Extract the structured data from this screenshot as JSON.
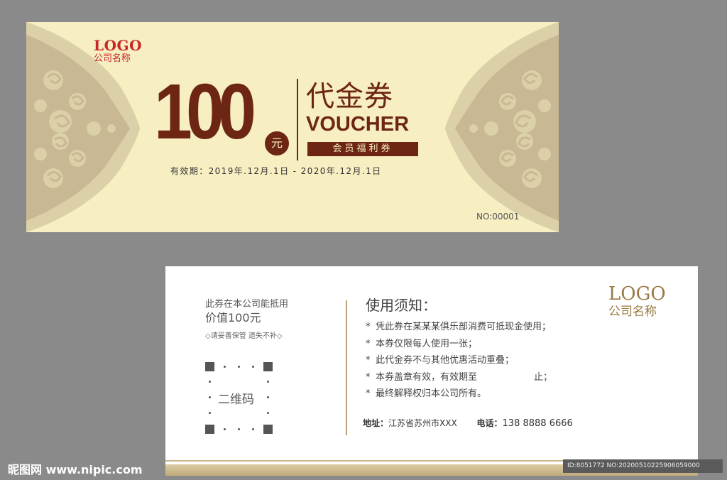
{
  "front": {
    "logo_mark": "LOGO",
    "logo_name": "公司名称",
    "amount": "100",
    "amount_unit": "元",
    "title_cn": "代金券",
    "title_en": "VOUCHER",
    "benefit": "会员福利券",
    "validity": "有效期：2019年.12月.1日 - 2020年.12月.1日",
    "serial": "NO:00001",
    "colors": {
      "background": "#f7eec2",
      "accent": "#6e2614",
      "ornament": "#c8b894",
      "logo": "#c7262b"
    }
  },
  "back": {
    "left_line1": "此券在本公司能抵用",
    "left_line2": "价值100元",
    "left_line3": "◇请妥善保管 遗失不补◇",
    "qr_label": "二维码",
    "notice_title": "使用须知：",
    "notices": [
      "凭此券在某某某俱乐部消费可抵现金使用；",
      "本券仅限每人使用一张；",
      "此代金券不与其他优惠活动重叠；",
      "本券盖章有效，有效期至",
      "最终解释权归本公司所有。"
    ],
    "notice_4_end": "止；",
    "bullet": "*",
    "address_label": "地址：",
    "address_value": "江苏省苏州市XXX",
    "phone_label": "电话：",
    "phone_value": "138 8888 6666",
    "logo_mark": "LOGO",
    "logo_name": "公司名称"
  },
  "watermark": {
    "left_brand": "昵图网",
    "left_site": "www.nipic.com",
    "right_text": "ID:8051772 NO:20200510225906059000"
  }
}
